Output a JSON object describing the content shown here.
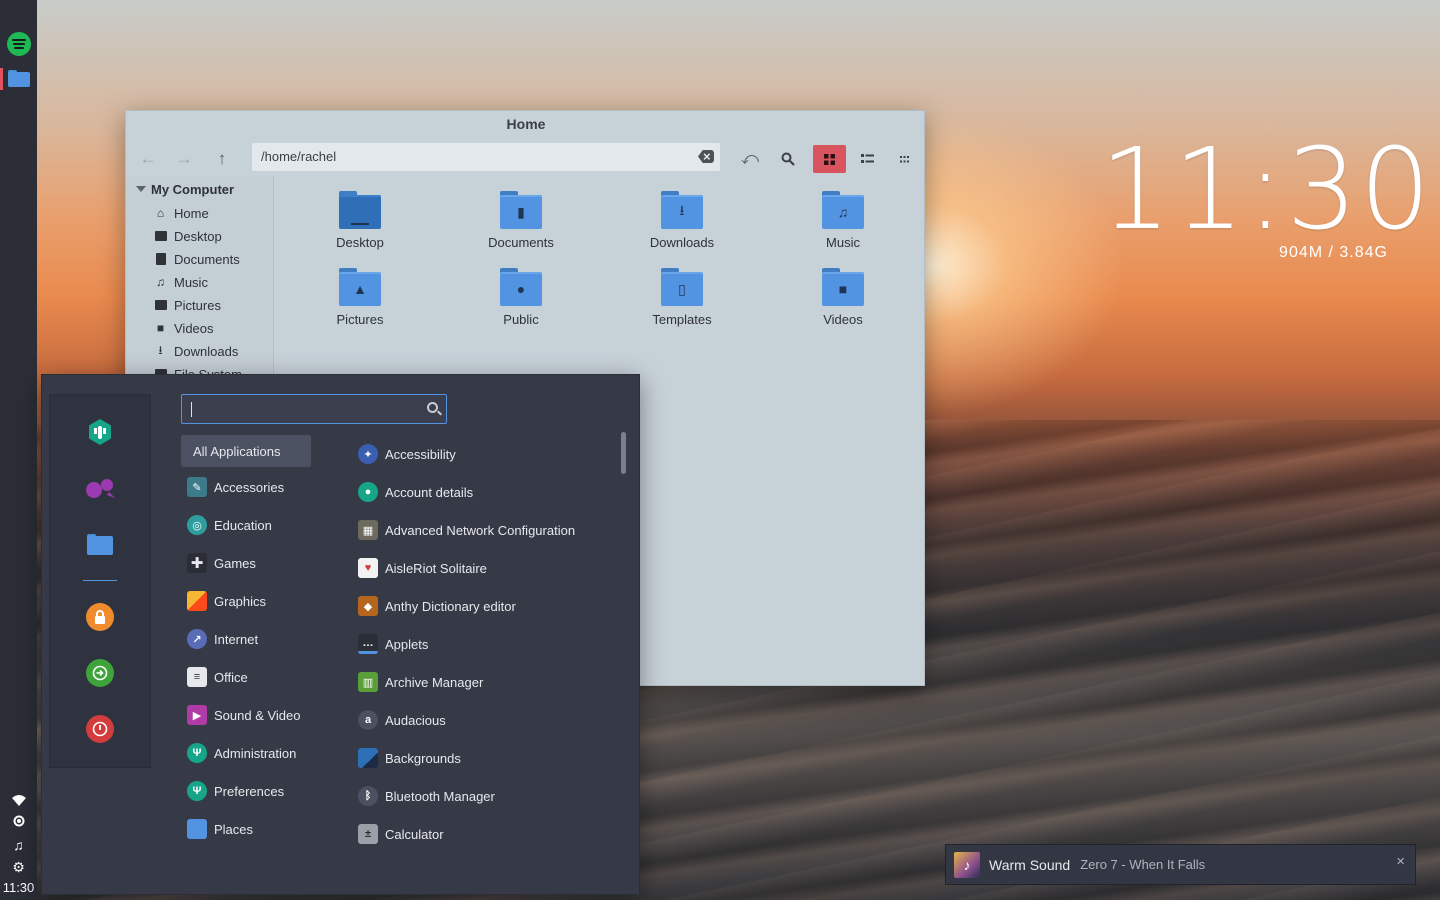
{
  "colors": {
    "accent": "#5294e2",
    "panel_bg": "#2b2e37",
    "menu_bg": "#363a47",
    "active_view": "#d8545f",
    "spotify_green": "#1db954"
  },
  "panel": {
    "launchers": [
      {
        "name": "Spotify",
        "icon": "spotify-icon"
      },
      {
        "name": "Files",
        "icon": "folder-icon"
      }
    ],
    "tray_icons": [
      "wifi-icon",
      "brightness-icon",
      "music-note-icon",
      "settings-gear-icon"
    ],
    "clock": "11:30"
  },
  "desklet": {
    "time": "11:30",
    "memory": "904M / 3.84G"
  },
  "file_manager": {
    "title": "Home",
    "toolbar": {
      "path": "/home/rachel",
      "icons": [
        "back-arrow-icon",
        "forward-arrow-icon",
        "up-arrow-icon",
        "clear-path-icon",
        "toggle-location-icon",
        "search-icon",
        "icon-view-icon",
        "list-view-icon",
        "compact-view-icon"
      ]
    },
    "sidebar": {
      "heading": "My Computer",
      "items": [
        {
          "label": "Home",
          "icon": "home-icon"
        },
        {
          "label": "Desktop",
          "icon": "desktop-icon"
        },
        {
          "label": "Documents",
          "icon": "document-icon"
        },
        {
          "label": "Music",
          "icon": "music-icon"
        },
        {
          "label": "Pictures",
          "icon": "picture-icon"
        },
        {
          "label": "Videos",
          "icon": "video-icon"
        },
        {
          "label": "Downloads",
          "icon": "download-icon"
        },
        {
          "label": "File System",
          "icon": "drive-icon"
        }
      ]
    },
    "folders": [
      {
        "label": "Desktop",
        "icon": "folder-desktop-icon"
      },
      {
        "label": "Documents",
        "icon": "folder-documents-icon"
      },
      {
        "label": "Downloads",
        "icon": "folder-downloads-icon"
      },
      {
        "label": "Music",
        "icon": "folder-music-icon"
      },
      {
        "label": "Pictures",
        "icon": "folder-pictures-icon"
      },
      {
        "label": "Public",
        "icon": "folder-public-icon"
      },
      {
        "label": "Templates",
        "icon": "folder-templates-icon"
      },
      {
        "label": "Videos",
        "icon": "folder-videos-icon"
      }
    ]
  },
  "menu": {
    "search": {
      "value": "",
      "placeholder": ""
    },
    "favorites": [
      "system-settings-icon",
      "pidgin-icon",
      "files-icon",
      "lock-screen-icon",
      "logout-icon",
      "shutdown-icon"
    ],
    "categories": [
      {
        "label": "All Applications",
        "selected": true
      },
      {
        "label": "Accessories",
        "icon": "accessories-icon"
      },
      {
        "label": "Education",
        "icon": "education-icon"
      },
      {
        "label": "Games",
        "icon": "games-icon"
      },
      {
        "label": "Graphics",
        "icon": "graphics-icon"
      },
      {
        "label": "Internet",
        "icon": "internet-icon"
      },
      {
        "label": "Office",
        "icon": "office-icon"
      },
      {
        "label": "Sound & Video",
        "icon": "sound-video-icon"
      },
      {
        "label": "Administration",
        "icon": "administration-icon"
      },
      {
        "label": "Preferences",
        "icon": "preferences-icon"
      },
      {
        "label": "Places",
        "icon": "places-icon"
      }
    ],
    "applications": [
      {
        "label": "Accessibility",
        "icon": "accessibility-icon"
      },
      {
        "label": "Account details",
        "icon": "account-details-icon"
      },
      {
        "label": "Advanced Network Configuration",
        "icon": "network-config-icon"
      },
      {
        "label": "AisleRiot Solitaire",
        "icon": "solitaire-icon"
      },
      {
        "label": "Anthy Dictionary editor",
        "icon": "dictionary-icon"
      },
      {
        "label": "Applets",
        "icon": "applets-icon"
      },
      {
        "label": "Archive Manager",
        "icon": "archive-icon"
      },
      {
        "label": "Audacious",
        "icon": "audacious-icon"
      },
      {
        "label": "Backgrounds",
        "icon": "backgrounds-icon"
      },
      {
        "label": "Bluetooth Manager",
        "icon": "bluetooth-icon"
      },
      {
        "label": "Calculator",
        "icon": "calculator-icon"
      }
    ]
  },
  "notification": {
    "title": "Warm Sound",
    "body": "Zero 7 - When It Falls",
    "close": "×"
  }
}
